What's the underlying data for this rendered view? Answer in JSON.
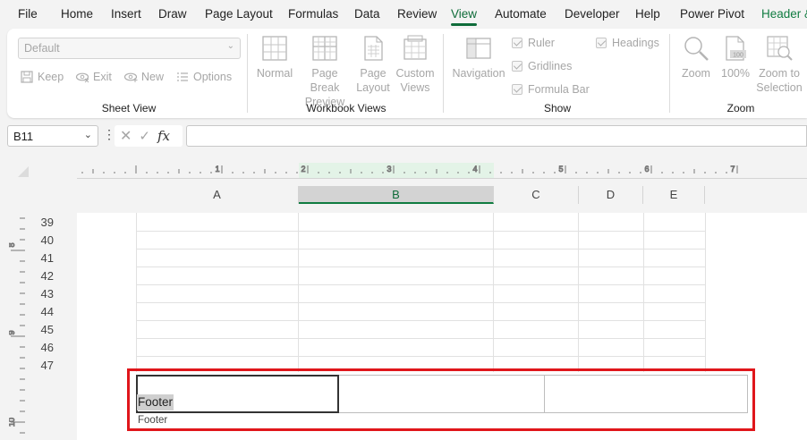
{
  "menu": {
    "items": [
      "File",
      "Home",
      "Insert",
      "Draw",
      "Page Layout",
      "Formulas",
      "Data",
      "Review",
      "View",
      "Automate",
      "Developer",
      "Help",
      "Power Pivot",
      "Header &"
    ],
    "active": "View"
  },
  "ribbon": {
    "sheet_view": {
      "dropdown_value": "Default",
      "keep": "Keep",
      "exit": "Exit",
      "new": "New",
      "options": "Options",
      "label": "Sheet View"
    },
    "workbook_views": {
      "normal": "Normal",
      "page_break_preview_1": "Page Break",
      "page_break_preview_2": "Preview",
      "page_layout_1": "Page",
      "page_layout_2": "Layout",
      "custom_views_1": "Custom",
      "custom_views_2": "Views",
      "label": "Workbook Views"
    },
    "show": {
      "navigation": "Navigation",
      "ruler": "Ruler",
      "gridlines": "Gridlines",
      "formula_bar": "Formula Bar",
      "headings": "Headings",
      "label": "Show"
    },
    "zoom": {
      "zoom": "Zoom",
      "hundred": "100%",
      "zoom_to_selection_1": "Zoom to",
      "zoom_to_selection_2": "Selection",
      "label": "Zoom"
    }
  },
  "formula_bar": {
    "name_box": "B11",
    "fx": "fx",
    "value": ""
  },
  "ruler": {
    "top_numbers": [
      "1",
      "2",
      "3",
      "4",
      "5",
      "6",
      "7"
    ],
    "left_numbers": [
      "8",
      "9",
      "10"
    ]
  },
  "columns": [
    "A",
    "B",
    "C",
    "D",
    "E"
  ],
  "selected_column": "B",
  "rows": [
    "39",
    "40",
    "41",
    "42",
    "43",
    "44",
    "45",
    "46",
    "47"
  ],
  "footer": {
    "left_text": "Footer",
    "label": "Footer"
  }
}
